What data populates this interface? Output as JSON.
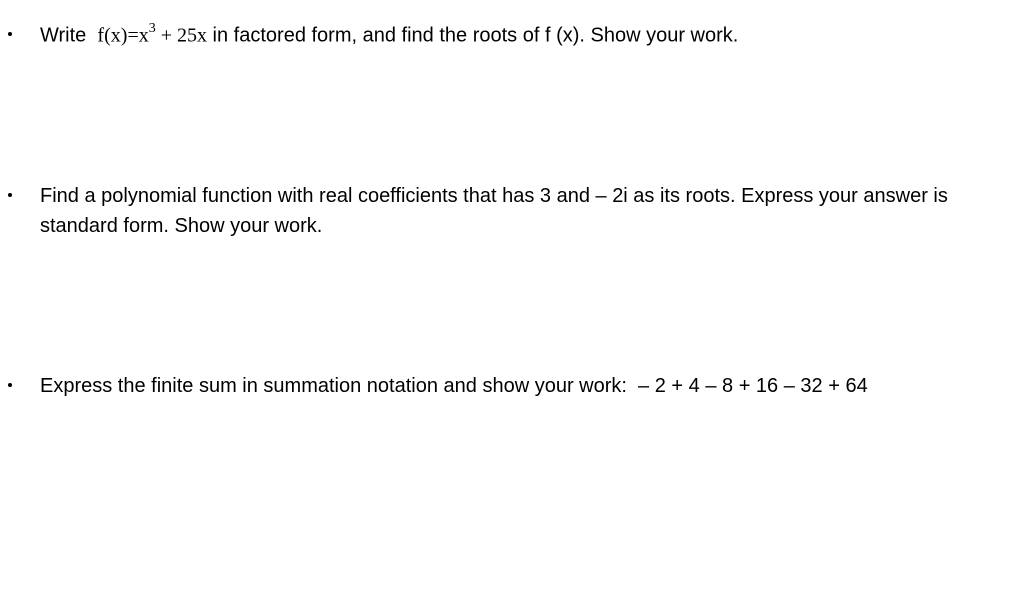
{
  "problems": [
    {
      "prefix": "Write  ",
      "math_fx": "f",
      "math_paren_open": "(",
      "math_x": "x",
      "math_paren_close": ")",
      "math_eq": "=",
      "math_rhs_base": "x",
      "math_rhs_exp": "3",
      "math_rhs_tail": " + 25x",
      "suffix": " in factored form, and find the roots of f (x). Show your work."
    },
    {
      "text": "Find a polynomial function with real coefficients that has 3 and – 2i as its roots. Express your answer is standard form. Show your work."
    },
    {
      "text": "Express the finite sum in summation notation and show your work:  – 2 + 4 – 8 + 16 – 32 + 64"
    }
  ]
}
